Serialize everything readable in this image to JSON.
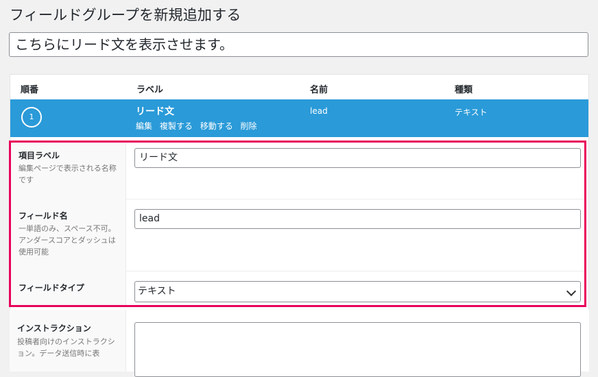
{
  "page": {
    "title": "フィールドグループを新規追加する",
    "lead_text": "こちらにリード文を表示させます。"
  },
  "table": {
    "headers": {
      "order": "順番",
      "label": "ラベル",
      "name": "名前",
      "type": "種類"
    },
    "active_row": {
      "order": "1",
      "label": "リード文",
      "actions": [
        "編集",
        "複製する",
        "移動する",
        "削除"
      ],
      "name": "lead",
      "type": "テキスト"
    }
  },
  "settings": {
    "item_label": {
      "title": "項目ラベル",
      "desc": "編集ページで表示される名称です",
      "value": "リード文"
    },
    "field_name": {
      "title": "フィールド名",
      "desc": "一単語のみ、スペース不可。アンダースコアとダッシュは使用可能",
      "value": "lead"
    },
    "field_type": {
      "title": "フィールドタイプ",
      "value": "テキスト"
    },
    "instructions": {
      "title": "インストラクション",
      "desc": "投稿者向けのインストラクション。データ送信時に表"
    }
  },
  "colors": {
    "active_row": "#2a9ad8",
    "highlight_border": "#e8005a"
  }
}
